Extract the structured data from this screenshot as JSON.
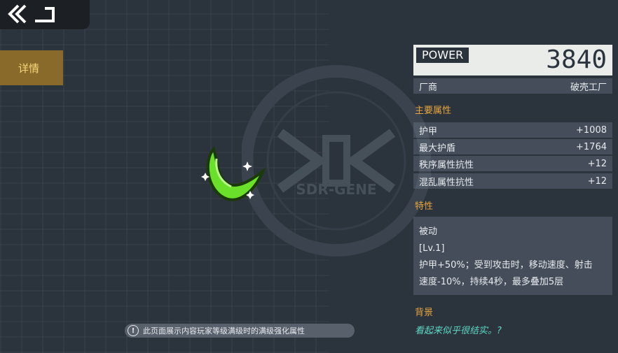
{
  "notice": "此页面展示内容玩家等级满级时的满级强化属性",
  "tab": {
    "detail_label": "详情"
  },
  "power": {
    "label": "POWER",
    "value": "3840"
  },
  "maker": {
    "label": "厂商",
    "value": "破壳工厂"
  },
  "main_attrs_title": "主要属性",
  "attrs": [
    {
      "name": "护甲",
      "value": "+1008"
    },
    {
      "name": "最大护盾",
      "value": "+1764"
    },
    {
      "name": "秩序属性抗性",
      "value": "+12"
    },
    {
      "name": "混乱属性抗性",
      "value": "+12"
    }
  ],
  "traits_title": "特性",
  "trait": {
    "type": "被动",
    "level": "[Lv.1]",
    "desc1": "护甲+50%；受到攻击时，移动速度、射击",
    "desc2": "速度-10%，持续4秒，最多叠加5层"
  },
  "background_title": "背景",
  "background_text": "看起来似乎很结实。?",
  "emblem_text": "SDR-GENE",
  "colors": {
    "accent": "#e7a640",
    "teal": "#5ed8c4",
    "item_green": "#6be02a"
  }
}
